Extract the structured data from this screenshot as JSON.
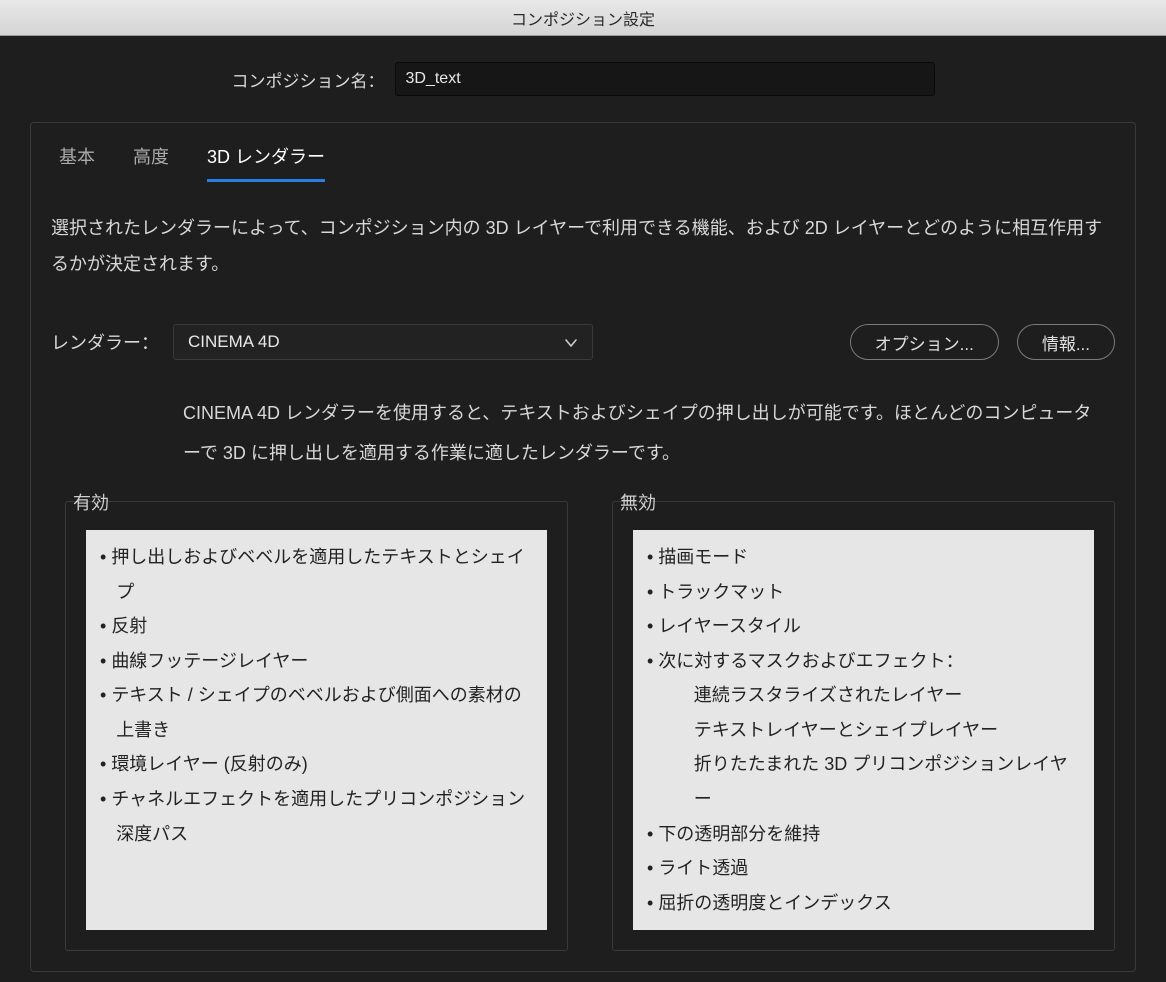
{
  "window_title": "コンポジション設定",
  "comp_name_label": "コンポジション名：",
  "comp_name_value": "3D_text",
  "tabs": {
    "basic": "基本",
    "advanced": "高度",
    "renderer3d": "3D レンダラー"
  },
  "description": "選択されたレンダラーによって、コンポジション内の 3D レイヤーで利用できる機能、および 2D レイヤーとどのように相互作用するかが決定されます。",
  "renderer_label": "レンダラー：",
  "renderer_selected": "CINEMA 4D",
  "buttons": {
    "options": "オプション...",
    "info": "情報..."
  },
  "renderer_description": "CINEMA 4D レンダラーを使用すると、テキストおよびシェイプの押し出しが可能です。ほとんどのコンピューターで 3D に押し出しを適用する作業に適したレンダラーです。",
  "enabled_label": "有効",
  "disabled_label": "無効",
  "enabled_items": [
    "押し出しおよびベベルを適用したテキストとシェイプ",
    "反射",
    "曲線フッテージレイヤー",
    "テキスト / シェイプのベベルおよび側面への素材の上書き",
    "環境レイヤー (反射のみ)",
    "チャネルエフェクトを適用したプリコンポジション深度パス"
  ],
  "disabled_items": [
    {
      "text": "描画モード"
    },
    {
      "text": "トラックマット"
    },
    {
      "text": "レイヤースタイル"
    },
    {
      "text": "次に対するマスクおよびエフェクト："
    },
    {
      "text": "連続ラスタライズされたレイヤー",
      "sub": true
    },
    {
      "text": "テキストレイヤーとシェイプレイヤー",
      "sub": true
    },
    {
      "text": "折りたたまれた 3D プリコンポジションレイヤー",
      "sub": true
    },
    {
      "text": "下の透明部分を維持"
    },
    {
      "text": "ライト透過"
    },
    {
      "text": "屈折の透明度とインデックス"
    }
  ]
}
